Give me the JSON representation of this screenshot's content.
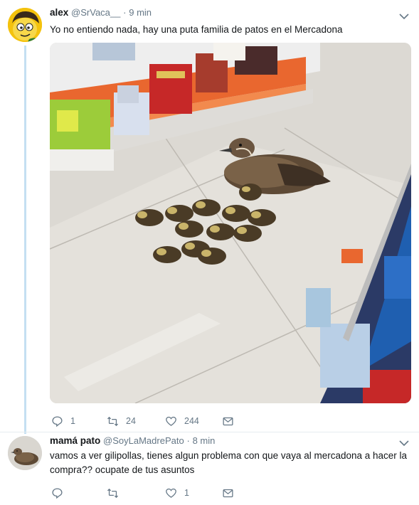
{
  "tweets": [
    {
      "name": "alex",
      "handle": "@SrVaca__",
      "separator": "·",
      "time": "9 min",
      "text": "Yo no entiendo nada, hay una puta familia de patos en el Mercadona",
      "actions": {
        "replies": "1",
        "retweets": "24",
        "likes": "244"
      },
      "avatar_icon": "cartoon-avatar-icon",
      "image_icon": "ducks-in-supermarket-photo"
    },
    {
      "name": "mamá pato",
      "handle": "@SoyLaMadrePato",
      "separator": "·",
      "time": "8 min",
      "text": "vamos a ver gilipollas, tienes algun problema con que vaya al mercadona a hacer la compra?? ocupate de tus asuntos",
      "actions": {
        "replies": "",
        "retweets": "",
        "likes": "1"
      },
      "avatar_icon": "duck-avatar-icon"
    }
  ],
  "colors": {
    "accent": "#1da1f2",
    "thread_line": "#c4dff2",
    "muted": "#657786",
    "text": "#14171a"
  }
}
